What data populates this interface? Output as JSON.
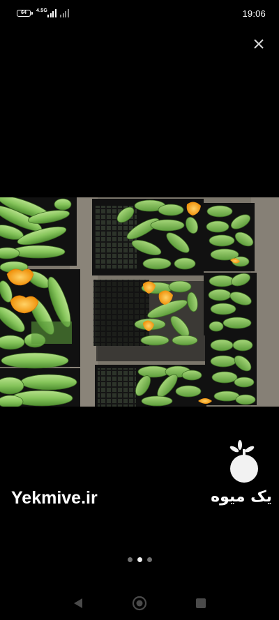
{
  "status_bar": {
    "battery_level": "64",
    "network_type": "4.5G",
    "time": "19:06"
  },
  "viewer": {
    "close_icon": "close-icon",
    "page_count": 3,
    "active_page": 2
  },
  "watermark": {
    "site": "Yekmive.ir",
    "brand_fa": "یک میوه",
    "logo_icon": "apple-logo-icon"
  },
  "nav_bar": {
    "back_icon": "back-triangle-icon",
    "home_icon": "home-circle-icon",
    "recents_icon": "recents-square-icon"
  }
}
